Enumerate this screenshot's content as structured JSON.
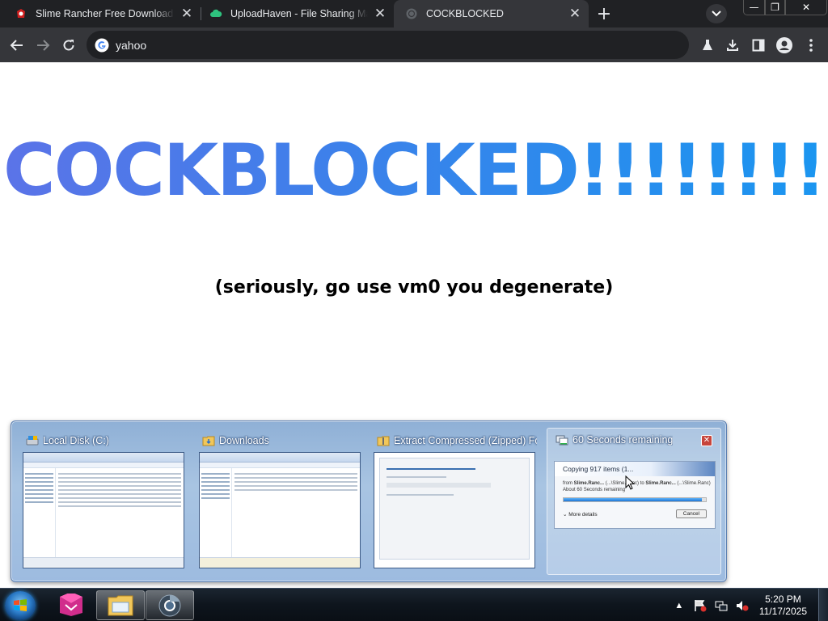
{
  "browser": {
    "tabs": [
      {
        "title": "Slime Rancher Free Download (v",
        "icon": "red-igg-icon",
        "active": false
      },
      {
        "title": "UploadHaven - File Sharing Made",
        "icon": "green-cloud-icon",
        "active": false
      },
      {
        "title": "COCKBLOCKED",
        "icon": "globe-icon",
        "active": true
      }
    ],
    "address": "yahoo"
  },
  "page": {
    "headline": "COCKBLOCKED!!!!!!!!",
    "subline": "(seriously, go use vm0 you degenerate)",
    "headline_gradient": [
      "#5b73e8",
      "#1a96f0"
    ]
  },
  "thumbnails": [
    {
      "title": "Local Disk (C:)",
      "kind": "explorer"
    },
    {
      "title": "Downloads",
      "kind": "explorer"
    },
    {
      "title": "Extract Compressed (Zipped) Fo...",
      "kind": "extract"
    },
    {
      "title": "60 Seconds remaining",
      "kind": "copy",
      "dialog": {
        "heading": "Copying 917 items (1...",
        "from_prefix": "from",
        "from_src": "Slime.Ranc...",
        "mid": "(...\\Slime.Ranc) to",
        "to_dst": "Slime.Ranc...",
        "tail": "(...\\Slime.Ranc)",
        "remaining": "About 60 Seconds remaining",
        "more_details": "More details",
        "cancel": "Cancel",
        "progress": 0.97
      }
    }
  ],
  "taskbar": {
    "time": "5:20 PM",
    "date": "11/17/2025"
  }
}
